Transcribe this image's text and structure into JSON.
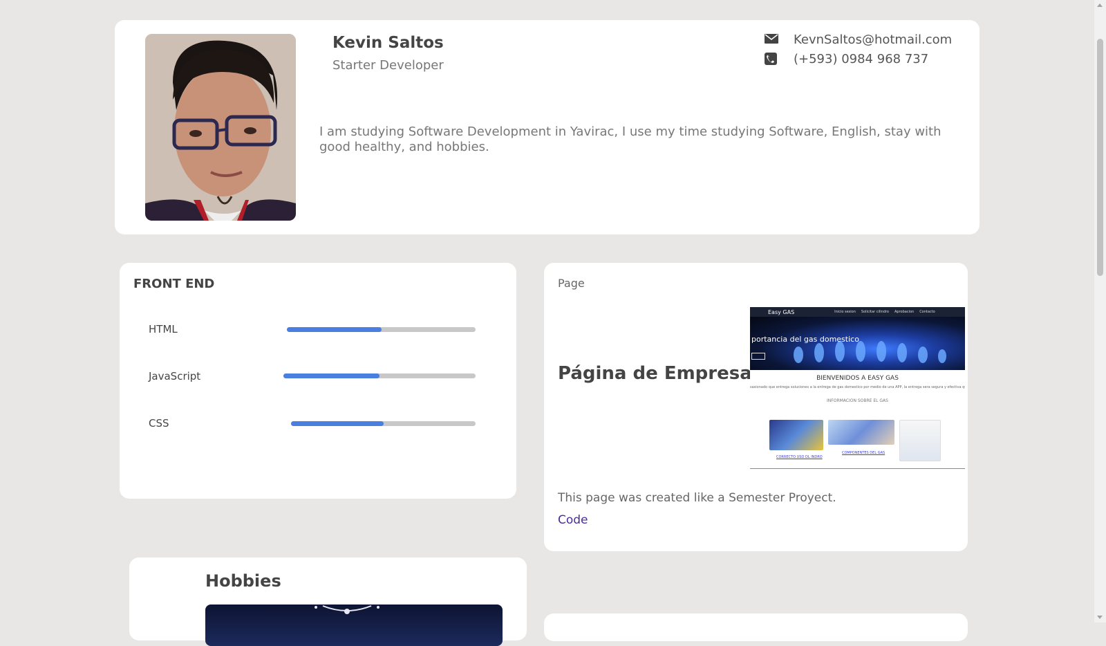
{
  "profile": {
    "name": "Kevin Saltos",
    "role": "Starter Developer",
    "email": "KevnSaltos@hotmail.com",
    "phone": "(+593) 0984 968 737",
    "bio": "I am studying Software Development in Yavirac, I use my time studying Software, English, stay with good healthy, and hobbies."
  },
  "skills": {
    "title": "FRONT END",
    "items": [
      {
        "label": "HTML",
        "level": 0.5
      },
      {
        "label": "JavaScript",
        "level": 0.5
      },
      {
        "label": "CSS",
        "level": 0.5
      }
    ]
  },
  "project": {
    "heading": "Page",
    "title": "Página de Empresa",
    "description": "This page was created like a Semester Proyect.",
    "link": "Code",
    "screenshot": {
      "brand": "Easy GAS",
      "nav": [
        "Inicio sesion",
        "Solicitar cilindro",
        "Aprobacion",
        "Contacto"
      ],
      "hero": "portancia del gas domestico",
      "welcome": "BIENVENIDOS A EASY GAS",
      "intro": "sasionado que entrega soluciones a la entrega de gas domestico por medio de una APP, la entrega sera segura y efectiva que mejorara la calidad de",
      "info": "INFORMACION SOBRE EL GAS",
      "captions": [
        "CORRECTO USO DL INDRO",
        "COMPONENTES DEL GAS"
      ]
    }
  },
  "hobbies": {
    "title": "Hobbies"
  },
  "colors": {
    "accent": "#4a7fe0",
    "link": "#4b2a9e",
    "background": "#e8e7e5"
  },
  "icons": {
    "email": "envelope-icon",
    "phone": "phone-icon"
  }
}
